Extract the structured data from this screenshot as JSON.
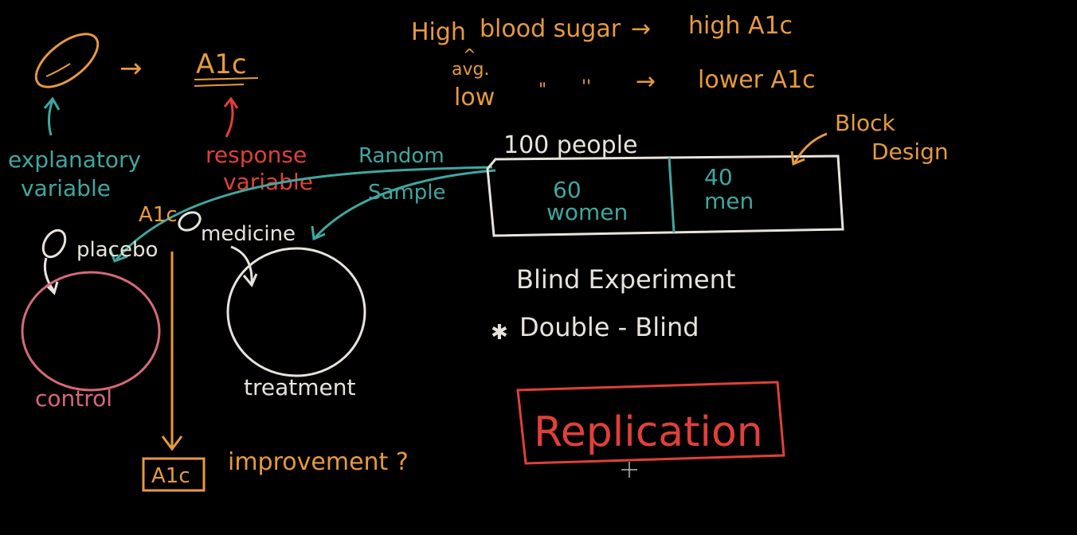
{
  "colors": {
    "background": "#000000",
    "orange": "#e79a3f",
    "teal": "#3fa7a0",
    "red": "#e0403a",
    "pink": "#d46a78",
    "white": "#e8e4dc"
  },
  "top_notes": {
    "line1_a": "High",
    "line1_b": "blood sugar",
    "line1_arrow": "→",
    "line1_c": "high A1c",
    "avg": "avg.",
    "caret": "^",
    "line2_a": "low",
    "line2_ditto1": "\"",
    "line2_ditto2": "''",
    "line2_arrow": "→",
    "line2_c": "lower A1c"
  },
  "variables": {
    "arrow": "→",
    "response_symbol": "A1c",
    "explanatory_label_1": "explanatory",
    "explanatory_label_2": "variable",
    "response_label_1": "response",
    "response_label_2": "variable"
  },
  "sampling": {
    "random_1": "Random",
    "random_2": "Sample",
    "people": "100 people",
    "group1_count": "60",
    "group1_label": "women",
    "group2_count": "40",
    "group2_label": "men",
    "block_1": "Block",
    "block_2": "Design"
  },
  "experiment": {
    "a1c_top": "A1c",
    "placebo": "placebo",
    "medicine": "medicine",
    "control": "control",
    "treatment": "treatment",
    "a1c_bottom": "A1c",
    "improvement": "improvement ?",
    "blind": "Blind Experiment",
    "double_blind_star": "✱",
    "double_blind": "Double - Blind",
    "replication": "Replication"
  },
  "icons": [
    "pill-icon",
    "pill-icon-small",
    "pill-icon-medicine",
    "cursor-crosshair-icon"
  ]
}
